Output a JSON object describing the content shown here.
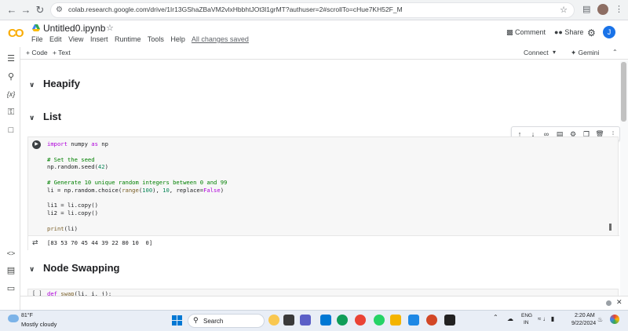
{
  "browser": {
    "url": "colab.research.google.com/drive/1Ir13GShaZBaVM2vlxHbbhtJOt3l1grMT?authuser=2#scrollTo=cHue7KH52F_M"
  },
  "header": {
    "logo": "CO",
    "title": "Untitled0.ipynb",
    "menu": [
      "File",
      "Edit",
      "View",
      "Insert",
      "Runtime",
      "Tools",
      "Help"
    ],
    "saved_status": "All changes saved",
    "comment_label": "Comment",
    "share_label": "Share",
    "user_initial": "J"
  },
  "toolbar": {
    "add_code": "+ Code",
    "add_text": "+ Text",
    "connect": "Connect",
    "gemini": "Gemini"
  },
  "sections": {
    "heapify": "Heapify",
    "list": "List",
    "node_swapping": "Node Swapping"
  },
  "cell1": {
    "lines": [
      "import numpy as np",
      "",
      "# Set the seed",
      "np.random.seed(42)",
      "",
      "# Generate 10 unique random integers between 0 and 99",
      "li = np.random.choice(range(100), 10, replace=False)",
      "",
      "li1 = li.copy()",
      "li2 = li.copy()",
      "",
      "print(li)"
    ],
    "output": "[83 53 70 45 44 39 22 80 10  0]"
  },
  "cell2": {
    "run_label": "[ ]",
    "code": "def swap(li, i, j):"
  },
  "taskbar": {
    "temp": "81°F",
    "weather": "Mostly cloudy",
    "search_placeholder": "Search",
    "lang": "ENG",
    "region": "IN",
    "time": "2:20 AM",
    "date": "9/22/2024"
  },
  "colors": {
    "accent": "#1a73e8",
    "logo_orange": "#f9ab00"
  }
}
